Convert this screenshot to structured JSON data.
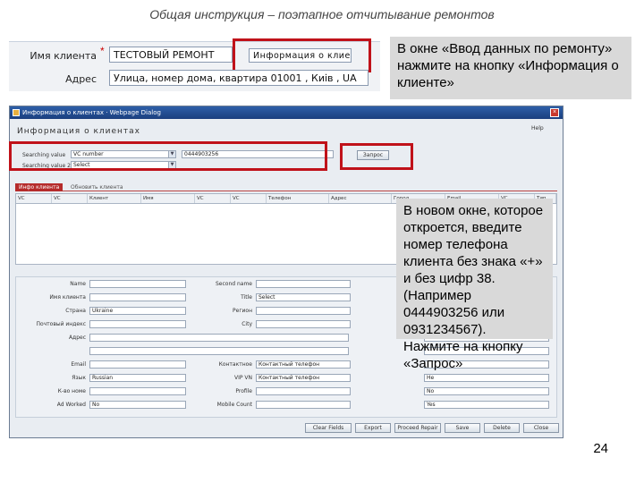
{
  "slide": {
    "title": "Общая инструкция – поэтапное отчитывание ремонтов",
    "page_number": "24"
  },
  "top_form": {
    "client_name_label": "Имя клиента",
    "client_name_value": "ТЕСТОВЫЙ РЕМОНТ",
    "client_info_button": "Информация о клие",
    "address_label": "Адрес",
    "address_value": "Улица, номер дома, квартира 01001 , Киів , UA"
  },
  "callouts": {
    "first": "В окне «Ввод данных по ремонту» нажмите на кнопку «Информация о клиенте»",
    "second": "В новом окне, которое откроется, введите номер телефона клиента без знака «+» и без цифр 38. (Например 0444903256 или 0931234567). Нажмите на кнопку «Запрос»"
  },
  "window": {
    "title": "Информация о клиентах  ·  Webpage Dialog",
    "help": "Help",
    "heading": "Информация о клиентах",
    "searching_value_label": "Searching value",
    "searching_value_select": "VC number",
    "searching_value2_label": "Searching value 2",
    "searching_value2_select": "Select",
    "search_input_value": "0444903256",
    "query_button": "Запрос",
    "tabs": [
      "Инфо клиента",
      "Обновить клиента"
    ],
    "grid_headers": [
      "VC",
      "VC",
      "Клиент",
      "Имя",
      "VC",
      "VC",
      "Телефон",
      "Адрес",
      "Город",
      "Email",
      "VC",
      "Тип"
    ],
    "form_rows_left": [
      "Name",
      "Имя клиента",
      "Страна",
      "Почтовый индекс",
      "Адрес",
      "",
      "Email",
      "Язык",
      "К-во номе",
      "Ad Worked"
    ],
    "form_rows_mid": [
      "Second name",
      "Title",
      "Регион",
      "City",
      "",
      "",
      "Контактное",
      "VIP VN",
      "Profile",
      "Mobile Count"
    ],
    "form_values_left": [
      "",
      "",
      "Ukraine",
      "",
      "",
      "",
      "",
      "Russian",
      "",
      "No"
    ],
    "form_values_mid": [
      "",
      "Select",
      "",
      "",
      "",
      "",
      "Контактный телефон",
      "Контактный телефон",
      "",
      ""
    ],
    "form_values_right": [
      "",
      "",
      "",
      "",
      "",
      "",
      "",
      "Не",
      "No",
      "Yes"
    ],
    "bottom_buttons": [
      "Clear Fields",
      "Export",
      "Proceed Repair",
      "Save",
      "Delete",
      "Close"
    ]
  },
  "colors": {
    "highlight": "#c0121a",
    "callout_bg": "#d9d9d9",
    "titlebar": "#1b3f7e"
  }
}
